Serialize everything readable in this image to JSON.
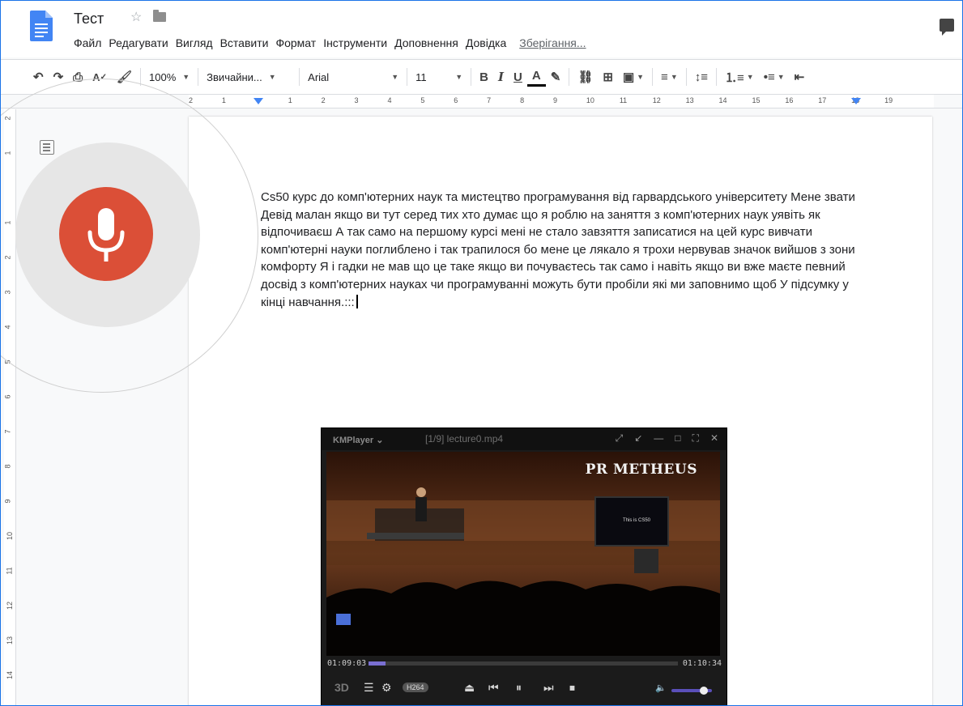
{
  "document": {
    "title": "Тест",
    "saving_status": "Зберігання...",
    "body_text": "Cs50 курс до комп'ютерних наук та мистецтво програмування від гарвардського університету Мене звати Девід малан якщо ви тут серед тих хто думає що я роблю на заняття з комп'ютерних наук уявіть як відпочиваєш А так само на першому курсі мені не стало завзяття записатися на цей курс вивчати комп'ютерні науки поглиблено і так трапилося бо мене це лякало я трохи нервував значок вийшов з зони комфорту Я і гадки не мав що це таке якщо ви почуваєтесь так само і навіть якщо ви вже маєте певний досвід з комп'ютерних науках чи програмуванні можуть бути пробіли які ми заповнимо щоб У підсумку у кінці навчання.:::"
  },
  "menu": {
    "file": "Файл",
    "edit": "Редагувати",
    "view": "Вигляд",
    "insert": "Вставити",
    "format": "Формат",
    "tools": "Інструменти",
    "addons": "Доповнення",
    "help": "Довідка"
  },
  "toolbar": {
    "zoom": "100%",
    "style": "Звичайни...",
    "font": "Arial",
    "font_size": "11",
    "bold": "B",
    "italic": "I",
    "underline": "U",
    "text_color": "A"
  },
  "ruler": {
    "h_labels": [
      "2",
      "1",
      "",
      "1",
      "2",
      "3",
      "4",
      "5",
      "6",
      "7",
      "8",
      "9",
      "10",
      "11",
      "12",
      "13",
      "14",
      "15",
      "16",
      "17",
      "18",
      "19"
    ],
    "v_labels": [
      "2",
      "1",
      "",
      "1",
      "2",
      "3",
      "4",
      "5",
      "6",
      "7",
      "8",
      "9",
      "10",
      "11",
      "12",
      "13",
      "14"
    ]
  },
  "voice_typing": {
    "mic_color": "#db4f37",
    "icon": "microphone-icon"
  },
  "kmplayer": {
    "app_name": "KMPlayer",
    "file_title": "[1/9] lecture0.mp4",
    "brand": "PR METHEUS",
    "time_elapsed": "01:09:03",
    "time_total": "01:10:34",
    "progress": 0.055,
    "volume": 0.8,
    "codec_badge": "H264",
    "mode_3d": "3D",
    "screen_text": "This is CS50"
  }
}
